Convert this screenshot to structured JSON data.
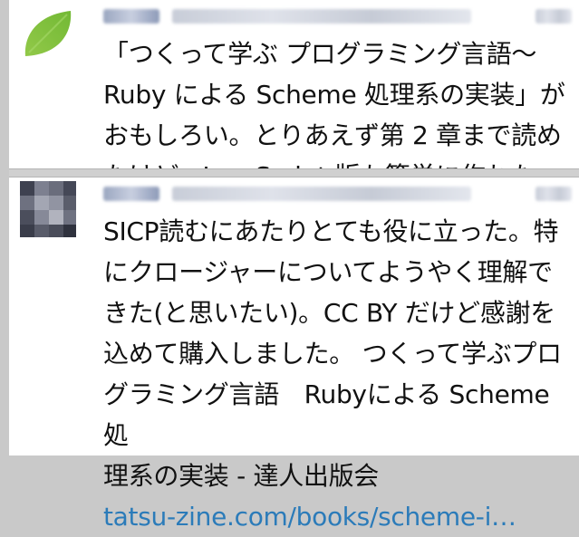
{
  "tweets": [
    {
      "text": "「つくって学ぶ プログラミング言語〜\nRuby による Scheme 処理系の実装」が\nおもしろい。とりあえず第 2 章まで読め\nたけど、JavaScript 版も簡単に作れた。",
      "link": ""
    },
    {
      "text": "SICP読むにあたりとても役に立った。特\nにクロージャーについてようやく理解で\nきた(と思いたい)。CC BY だけど感謝を\n込めて購入しました。 つくって学ぶプロ\nグラミング言語　Rubyによる Scheme処\n理系の実装 - 達人出版会",
      "link": "tatsu-zine.com/books/scheme-i…"
    }
  ],
  "colors": {
    "background": "#c9c9c9",
    "card": "#ffffff",
    "text": "#111111",
    "link": "#2b7bb9"
  },
  "icons": [
    "leaf-avatar-icon",
    "pixelated-avatar-icon"
  ]
}
